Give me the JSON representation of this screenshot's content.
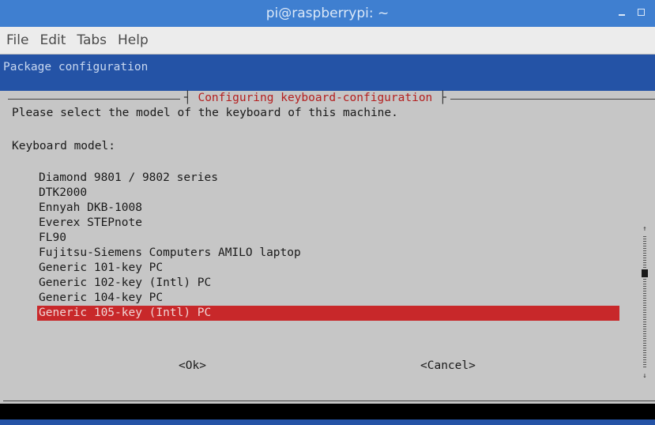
{
  "window": {
    "title": "pi@raspberrypi: ~",
    "controls": [
      "minimize-icon",
      "maximize-icon"
    ]
  },
  "menu": [
    "File",
    "Edit",
    "Tabs",
    "Help"
  ],
  "terminal": {
    "package_header": "Package configuration",
    "dialog": {
      "title": "Configuring keyboard-configuration",
      "prompt": "Please select the model of the keyboard of this machine.",
      "field_label": "Keyboard model:",
      "items": [
        "Diamond 9801 / 9802 series",
        "DTK2000",
        "Ennyah DKB-1008",
        "Everex STEPnote",
        "FL90",
        "Fujitsu-Siemens Computers AMILO laptop",
        "Generic 101-key PC",
        "Generic 102-key (Intl) PC",
        "Generic 104-key PC",
        "Generic 105-key (Intl) PC"
      ],
      "selected_index": 9,
      "ok_label": "<Ok>",
      "cancel_label": "<Cancel>",
      "scroll_up": "↑",
      "scroll_down": "↓"
    }
  },
  "colors": {
    "titlebar": "#3f7fd0",
    "package_bar": "#2453a6",
    "dialog_bg": "#c6c6c6",
    "dialog_title": "#b42020",
    "selection": "#c8282a"
  }
}
